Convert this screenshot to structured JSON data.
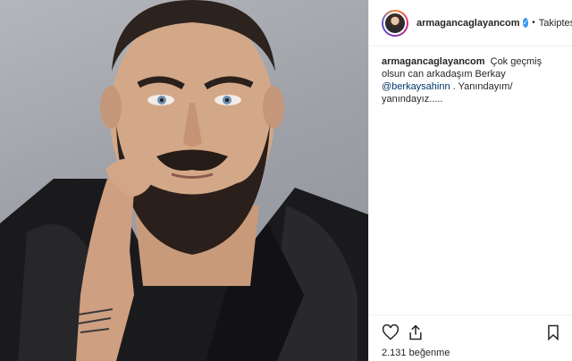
{
  "post": {
    "author": {
      "username": "armagancaglayancom",
      "verified": true,
      "follow_status": "Takiptesin",
      "icons": [
        "verified-badge-icon",
        "avatar"
      ]
    },
    "caption": {
      "username": "armagancaglayancom",
      "text_before_mention": "Çok geçmiş olsun can arkadaşım Berkay",
      "mention": "@berkaysahinn",
      "text_after_mention": ". Yanındayım/ yanındayız....."
    },
    "actions": {
      "icons": [
        "heart-icon",
        "share-icon",
        "bookmark-icon"
      ]
    },
    "likes_text": "2.131 beğenme"
  },
  "colors": {
    "verified_blue": "#3897f0",
    "mention_blue": "#003569",
    "text": "#262626",
    "divider": "#efefef"
  }
}
